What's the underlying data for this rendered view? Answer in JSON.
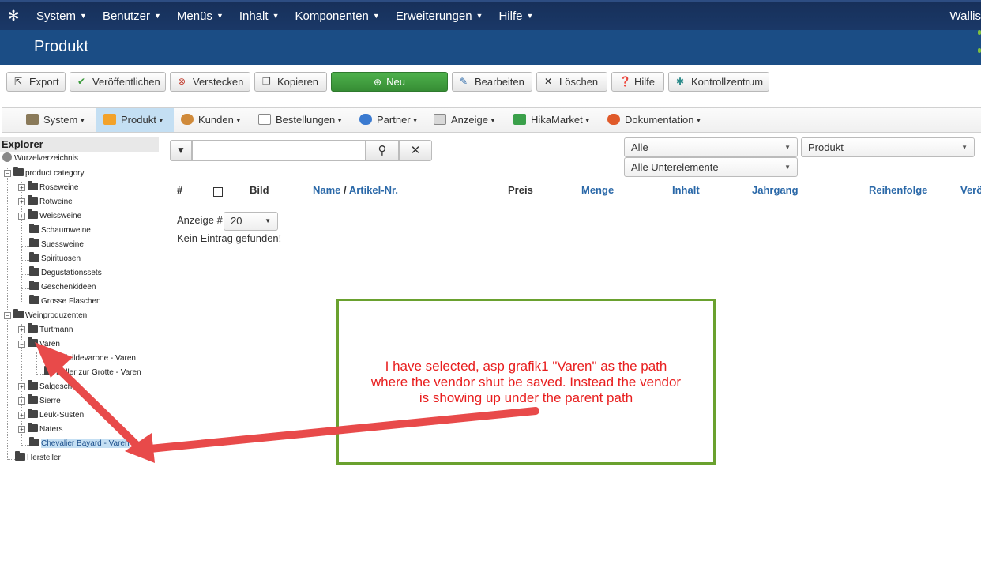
{
  "topbar": {
    "menu": [
      {
        "label": "System"
      },
      {
        "label": "Benutzer"
      },
      {
        "label": "Menüs"
      },
      {
        "label": "Inhalt"
      },
      {
        "label": "Komponenten"
      },
      {
        "label": "Erweiterungen"
      },
      {
        "label": "Hilfe"
      }
    ],
    "user": "Wallis"
  },
  "title": "Produkt",
  "toolbar": {
    "export": "Export",
    "publish": "Veröffentlichen",
    "hide": "Verstecken",
    "copy": "Kopieren",
    "new": "Neu",
    "edit": "Bearbeiten",
    "delete": "Löschen",
    "help": "Hilfe",
    "control_center": "Kontrollzentrum"
  },
  "hikamenu": {
    "system": "System",
    "product": "Produkt",
    "customers": "Kunden",
    "orders": "Bestellungen",
    "partner": "Partner",
    "display": "Anzeige",
    "hikamarket": "HikaMarket",
    "docs": "Dokumentation"
  },
  "explorer": {
    "title": "Explorer",
    "root": "Wurzelverzeichnis",
    "product_category": "product category",
    "categories": [
      "Roseweine",
      "Rotweine",
      "Weissweine",
      "Schaumweine",
      "Suessweine",
      "Spirituosen",
      "Degustationssets",
      "Geschenkideen",
      "Grosse Flaschen"
    ],
    "producers": "Weinproduzenten",
    "turtmann": "Turtmann",
    "varen": "Varen",
    "varen_children": [
      "Soleildevarone - Varen",
      "Keller zur Grotte - Varen"
    ],
    "more": [
      "Salgesch",
      "Sierre",
      "Leuk-Susten",
      "Naters"
    ],
    "selected": "Chevalier Bayard - Varen",
    "manufacturer": "Hersteller"
  },
  "filter": {
    "search_value": "",
    "select1": "Alle",
    "select2": "Produkt",
    "select3": "Alle Unterelemente"
  },
  "table": {
    "hash": "#",
    "image": "Bild",
    "name": "Name",
    "slash": "/",
    "sku": "Artikel-Nr.",
    "price": "Preis",
    "quantity": "Menge",
    "content": "Inhalt",
    "vintage": "Jahrgang",
    "order": "Reihenfolge",
    "published_partial": "Verö"
  },
  "pagination": {
    "label": "Anzeige #",
    "value": "20"
  },
  "empty": "Kein Eintrag gefunden!",
  "annotation": {
    "line1": "I have selected, asp grafik1 \"Varen\" as the path",
    "line2": "where the vendor shut be saved. Instead the vendor",
    "line3": "is showing up under the parent path"
  },
  "colors": {
    "topbar": "#1a3867",
    "titlebar": "#1b4d85",
    "new_button": "#46a546",
    "link": "#2a68a8",
    "annotation_border": "#6aa12f",
    "annotation_text": "#e81e1e",
    "arrow": "#e84a4a"
  }
}
